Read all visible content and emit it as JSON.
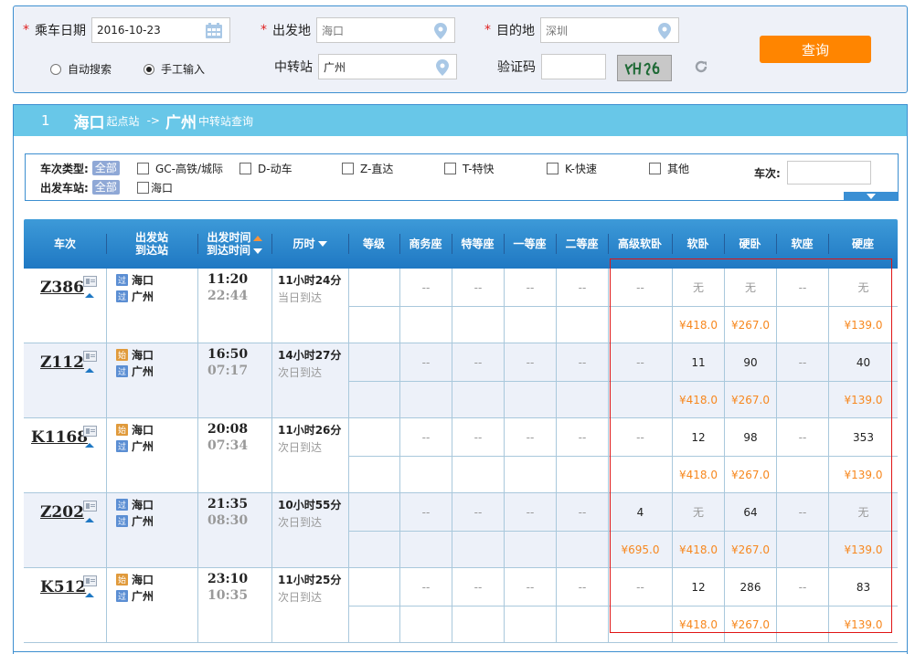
{
  "search": {
    "date_label": "乘车日期",
    "date_value": "2016-10-23",
    "from_label": "出发地",
    "from_value": "海口",
    "to_label": "目的地",
    "to_value": "深圳",
    "transfer_label": "中转站",
    "transfer_value": "广州",
    "captcha_label": "验证码",
    "captcha_value": "",
    "captcha_image_text": "YHg6",
    "radio_auto": "自动搜索",
    "radio_manual": "手工输入",
    "radio_selected": "manual",
    "required_mark": "*",
    "query_button": "查询"
  },
  "result": {
    "index": "1",
    "from_city": "海口",
    "from_suffix": "起点站",
    "arrow": "->",
    "to_city": "广州",
    "to_suffix": "中转站查询"
  },
  "filter": {
    "type_label": "车次类型:",
    "all_tag": "全部",
    "types": [
      "GC-高铁/城际",
      "D-动车",
      "Z-直达",
      "T-特快",
      "K-快速",
      "其他"
    ],
    "station_label": "出发车站:",
    "stations": [
      "海口"
    ],
    "train_no_label": "车次:",
    "train_no_value": ""
  },
  "table": {
    "headers": {
      "train": "车次",
      "station_top": "出发站",
      "station_bottom": "到达站",
      "time_top": "出发时间",
      "time_bottom": "到达时间",
      "duration": "历时",
      "grade": "等级",
      "business": "商务座",
      "special": "特等座",
      "first": "一等座",
      "second": "二等座",
      "deluxe_sleeper": "高级软卧",
      "soft_sleeper": "软卧",
      "hard_sleeper": "硬卧",
      "soft_seat": "软座",
      "hard_seat": "硬座"
    },
    "badge_pass": "过",
    "badge_start": "始",
    "rows": [
      {
        "train": "Z386",
        "from_badge": "过",
        "from": "海口",
        "to_badge": "过",
        "to": "广州",
        "dep": "11:20",
        "arr": "22:44",
        "duration": "11小时24分",
        "arrival_day": "当日到达",
        "business": "--",
        "special": "--",
        "first": "--",
        "second": "--",
        "deluxe": "--",
        "soft_sleeper": "无",
        "hard_sleeper": "无",
        "soft_seat": "--",
        "hard_seat": "无",
        "deluxe_price": "",
        "soft_sleeper_price": "¥418.0",
        "hard_sleeper_price": "¥267.0",
        "hard_seat_price": "¥139.0"
      },
      {
        "train": "Z112",
        "from_badge": "始",
        "from": "海口",
        "to_badge": "过",
        "to": "广州",
        "dep": "16:50",
        "arr": "07:17",
        "duration": "14小时27分",
        "arrival_day": "次日到达",
        "business": "--",
        "special": "--",
        "first": "--",
        "second": "--",
        "deluxe": "--",
        "soft_sleeper": "11",
        "hard_sleeper": "90",
        "soft_seat": "--",
        "hard_seat": "40",
        "deluxe_price": "",
        "soft_sleeper_price": "¥418.0",
        "hard_sleeper_price": "¥267.0",
        "hard_seat_price": "¥139.0"
      },
      {
        "train": "K1168",
        "from_badge": "始",
        "from": "海口",
        "to_badge": "过",
        "to": "广州",
        "dep": "20:08",
        "arr": "07:34",
        "duration": "11小时26分",
        "arrival_day": "次日到达",
        "business": "--",
        "special": "--",
        "first": "--",
        "second": "--",
        "deluxe": "--",
        "soft_sleeper": "12",
        "hard_sleeper": "98",
        "soft_seat": "--",
        "hard_seat": "353",
        "deluxe_price": "",
        "soft_sleeper_price": "¥418.0",
        "hard_sleeper_price": "¥267.0",
        "hard_seat_price": "¥139.0"
      },
      {
        "train": "Z202",
        "from_badge": "过",
        "from": "海口",
        "to_badge": "过",
        "to": "广州",
        "dep": "21:35",
        "arr": "08:30",
        "duration": "10小时55分",
        "arrival_day": "次日到达",
        "business": "--",
        "special": "--",
        "first": "--",
        "second": "--",
        "deluxe": "4",
        "soft_sleeper": "无",
        "hard_sleeper": "64",
        "soft_seat": "--",
        "hard_seat": "无",
        "deluxe_price": "¥695.0",
        "soft_sleeper_price": "¥418.0",
        "hard_sleeper_price": "¥267.0",
        "hard_seat_price": "¥139.0"
      },
      {
        "train": "K512",
        "from_badge": "始",
        "from": "海口",
        "to_badge": "过",
        "to": "广州",
        "dep": "23:10",
        "arr": "10:35",
        "duration": "11小时25分",
        "arrival_day": "次日到达",
        "business": "--",
        "special": "--",
        "first": "--",
        "second": "--",
        "deluxe": "--",
        "soft_sleeper": "12",
        "hard_sleeper": "286",
        "soft_seat": "--",
        "hard_seat": "83",
        "deluxe_price": "",
        "soft_sleeper_price": "¥418.0",
        "hard_sleeper_price": "¥267.0",
        "hard_seat_price": "¥139.0"
      }
    ]
  },
  "colors": {
    "accent_blue": "#3d8fd0",
    "header_bar": "#68c7e8",
    "query_button": "#ff8500",
    "price": "#f7881f",
    "highlight": "#e01515"
  }
}
